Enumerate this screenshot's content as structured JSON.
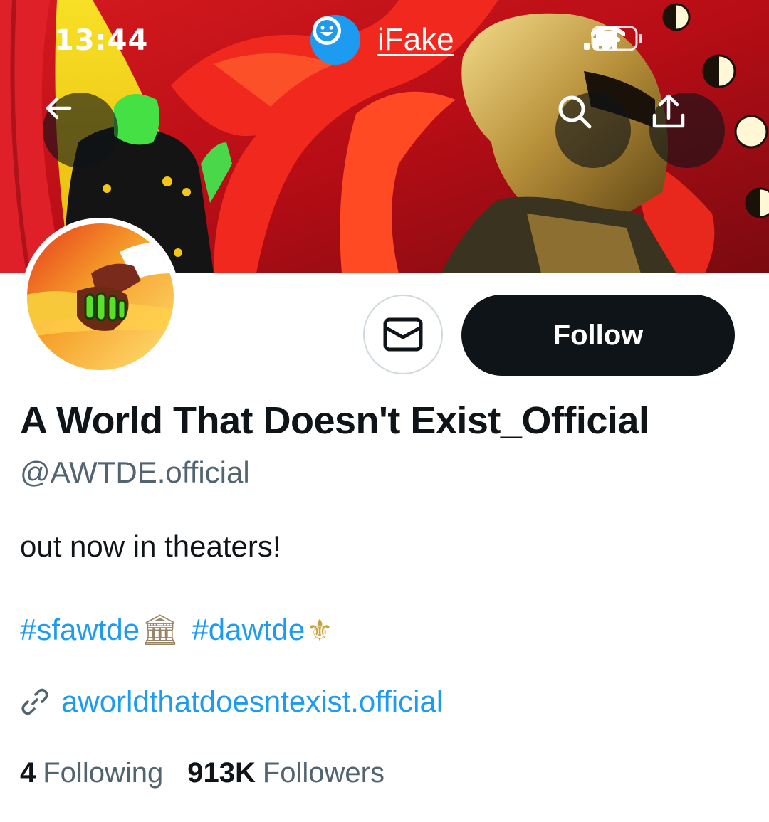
{
  "status_bar": {
    "time": "13:44",
    "carrier_app": "iFake"
  },
  "icons": {
    "back": "arrow-left-icon",
    "search": "search-icon",
    "share": "share-icon",
    "message": "mail-icon",
    "link": "link-icon",
    "signal": "signal-icon",
    "wifi": "wifi-icon",
    "battery": "battery-icon"
  },
  "profile": {
    "display_name": "A World That Doesn't Exist_Official",
    "handle": "@AWTDE.official",
    "bio": "out now in theaters!",
    "hashtags": [
      {
        "tag": "#sfawtde",
        "emoji": "🏛"
      },
      {
        "tag": "#dawtde",
        "emoji": "⚜"
      }
    ],
    "website": "aworldthatdoesntexist.official"
  },
  "actions": {
    "follow_label": "Follow"
  },
  "stats": {
    "following_count": "4",
    "following_label": "Following",
    "followers_count": "913K",
    "followers_label": "Followers"
  },
  "colors": {
    "accent": "#1d9bf0",
    "text_primary": "#0f1419",
    "text_secondary": "#536471",
    "button_dark": "#0f1419",
    "border": "#cfd9de"
  }
}
